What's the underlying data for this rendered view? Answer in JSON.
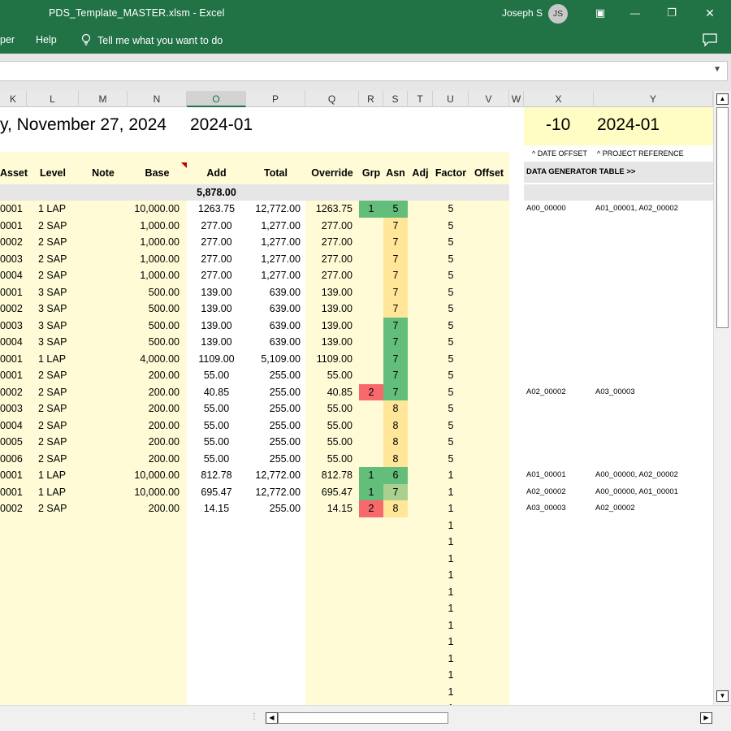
{
  "window": {
    "title": "PDS_Template_MASTER.xlsm  -  Excel",
    "user_name": "Joseph S",
    "user_initials": "JS",
    "minimize": "—",
    "restore": "❐",
    "close": "✕",
    "ribbon_display": "▣"
  },
  "ribbon": {
    "tab_partial": "per",
    "tab_help": "Help",
    "tell_me": "Tell me what you want to do"
  },
  "formula_bar": {
    "value": ""
  },
  "columns": [
    "K",
    "L",
    "M",
    "N",
    "O",
    "P",
    "Q",
    "R",
    "S",
    "T",
    "U",
    "V",
    "W",
    "X",
    "Y"
  ],
  "selected_column": "O",
  "sheet": {
    "date_text": "y, November 27, 2024",
    "period": "2024-01",
    "offset_value": "-10",
    "project_period": "2024-01",
    "note_date_offset": "^ DATE OFFSET",
    "note_project_ref": "^ PROJECT REFERENCE",
    "generator_label": "DATA GENERATOR TABLE >>",
    "add_total": "5,878.00"
  },
  "headers": {
    "asset": "Asset",
    "level": "Level",
    "note": "Note",
    "base": "Base",
    "add": "Add",
    "total": "Total",
    "override": "Override",
    "grp": "Grp",
    "asn": "Asn",
    "adj": "Adj",
    "factor": "Factor",
    "offset": "Offset"
  },
  "rows": [
    {
      "asset": "0001",
      "level": "1 LAP",
      "base": "10,000.00",
      "add": "1263.75",
      "total": "12,772.00",
      "override": "1263.75",
      "grp": "1",
      "asn": "5",
      "factor": "5",
      "gen_x": "A00_00000",
      "gen_y": "A01_00001, A02_00002"
    },
    {
      "asset": "0001",
      "level": "2 SAP",
      "base": "1,000.00",
      "add": "277.00",
      "total": "1,277.00",
      "override": "277.00",
      "grp": "",
      "asn": "7",
      "factor": "5",
      "gen_x": "",
      "gen_y": ""
    },
    {
      "asset": "0002",
      "level": "2 SAP",
      "base": "1,000.00",
      "add": "277.00",
      "total": "1,277.00",
      "override": "277.00",
      "grp": "",
      "asn": "7",
      "factor": "5",
      "gen_x": "",
      "gen_y": ""
    },
    {
      "asset": "0003",
      "level": "2 SAP",
      "base": "1,000.00",
      "add": "277.00",
      "total": "1,277.00",
      "override": "277.00",
      "grp": "",
      "asn": "7",
      "factor": "5",
      "gen_x": "",
      "gen_y": ""
    },
    {
      "asset": "0004",
      "level": "2 SAP",
      "base": "1,000.00",
      "add": "277.00",
      "total": "1,277.00",
      "override": "277.00",
      "grp": "",
      "asn": "7",
      "factor": "5",
      "gen_x": "",
      "gen_y": ""
    },
    {
      "asset": "0001",
      "level": "3 SAP",
      "base": "500.00",
      "add": "139.00",
      "total": "639.00",
      "override": "139.00",
      "grp": "",
      "asn": "7",
      "factor": "5",
      "gen_x": "",
      "gen_y": ""
    },
    {
      "asset": "0002",
      "level": "3 SAP",
      "base": "500.00",
      "add": "139.00",
      "total": "639.00",
      "override": "139.00",
      "grp": "",
      "asn": "7",
      "factor": "5",
      "gen_x": "",
      "gen_y": ""
    },
    {
      "asset": "0003",
      "level": "3 SAP",
      "base": "500.00",
      "add": "139.00",
      "total": "639.00",
      "override": "139.00",
      "grp": "",
      "asn": "7",
      "factor": "5",
      "gen_x": "",
      "gen_y": ""
    },
    {
      "asset": "0004",
      "level": "3 SAP",
      "base": "500.00",
      "add": "139.00",
      "total": "639.00",
      "override": "139.00",
      "grp": "",
      "asn": "7",
      "factor": "5",
      "gen_x": "",
      "gen_y": ""
    },
    {
      "asset": "0001",
      "level": "1 LAP",
      "base": "4,000.00",
      "add": "1109.00",
      "total": "5,109.00",
      "override": "1109.00",
      "grp": "",
      "asn": "7",
      "factor": "5",
      "gen_x": "",
      "gen_y": ""
    },
    {
      "asset": "0001",
      "level": "2 SAP",
      "base": "200.00",
      "add": "55.00",
      "total": "255.00",
      "override": "55.00",
      "grp": "",
      "asn": "7",
      "factor": "5",
      "gen_x": "",
      "gen_y": ""
    },
    {
      "asset": "0002",
      "level": "2 SAP",
      "base": "200.00",
      "add": "40.85",
      "total": "255.00",
      "override": "40.85",
      "grp": "2",
      "asn": "7",
      "factor": "5",
      "gen_x": "A02_00002",
      "gen_y": "A03_00003"
    },
    {
      "asset": "0003",
      "level": "2 SAP",
      "base": "200.00",
      "add": "55.00",
      "total": "255.00",
      "override": "55.00",
      "grp": "",
      "asn": "8",
      "factor": "5",
      "gen_x": "",
      "gen_y": ""
    },
    {
      "asset": "0004",
      "level": "2 SAP",
      "base": "200.00",
      "add": "55.00",
      "total": "255.00",
      "override": "55.00",
      "grp": "",
      "asn": "8",
      "factor": "5",
      "gen_x": "",
      "gen_y": ""
    },
    {
      "asset": "0005",
      "level": "2 SAP",
      "base": "200.00",
      "add": "55.00",
      "total": "255.00",
      "override": "55.00",
      "grp": "",
      "asn": "8",
      "factor": "5",
      "gen_x": "",
      "gen_y": ""
    },
    {
      "asset": "0006",
      "level": "2 SAP",
      "base": "200.00",
      "add": "55.00",
      "total": "255.00",
      "override": "55.00",
      "grp": "",
      "asn": "8",
      "factor": "5",
      "gen_x": "",
      "gen_y": ""
    },
    {
      "asset": "0001",
      "level": "1 LAP",
      "base": "10,000.00",
      "add": "812.78",
      "total": "12,772.00",
      "override": "812.78",
      "grp": "1",
      "asn": "6",
      "factor": "1",
      "gen_x": "A01_00001",
      "gen_y": "A00_00000, A02_00002"
    },
    {
      "asset": "0001",
      "level": "1 LAP",
      "base": "10,000.00",
      "add": "695.47",
      "total": "12,772.00",
      "override": "695.47",
      "grp": "1",
      "asn": "7",
      "factor": "1",
      "gen_x": "A02_00002",
      "gen_y": "A00_00000, A01_00001"
    },
    {
      "asset": "0002",
      "level": "2 SAP",
      "base": "200.00",
      "add": "14.15",
      "total": "255.00",
      "override": "14.15",
      "grp": "2",
      "asn": "8",
      "factor": "1",
      "gen_x": "A03_00003",
      "gen_y": "A02_00002"
    }
  ],
  "extra_factor_rows": [
    "1",
    "1",
    "1",
    "1",
    "1",
    "1",
    "1",
    "1",
    "1",
    "1",
    "1",
    "1"
  ],
  "colors": {
    "excel_green": "#217346",
    "cream": "#FFFBD6",
    "note_yellow": "#FFFCC4",
    "header_grey": "#E7E6E6",
    "grp_green": "#63BE7B",
    "grp_red": "#F8696B",
    "asn_yellow": "#FFE699",
    "asn_green": "#63BE7B",
    "asn_lightgreen": "#A9D08E",
    "comment_red": "#C00000"
  },
  "cell_fills": {
    "grp": [
      "green",
      "",
      "",
      "",
      "",
      "",
      "",
      "",
      "",
      "",
      "",
      "red",
      "",
      "",
      "",
      "",
      "green",
      "green",
      "red"
    ],
    "asn": [
      "green",
      "yellow",
      "yellow",
      "yellow",
      "yellow",
      "yellow",
      "yellow",
      "green",
      "green",
      "green",
      "green",
      "green",
      "yellow",
      "yellow",
      "yellow",
      "yellow",
      "green",
      "lightgreen",
      "yellow"
    ]
  },
  "icons": [
    "ribbon-display-icon",
    "minimize-icon",
    "restore-icon",
    "close-icon",
    "lightbulb-icon",
    "comment-icon",
    "chevron-down-icon",
    "scroll-up-arrow-icon",
    "scroll-down-arrow-icon",
    "scroll-left-arrow-icon",
    "scroll-right-arrow-icon"
  ]
}
